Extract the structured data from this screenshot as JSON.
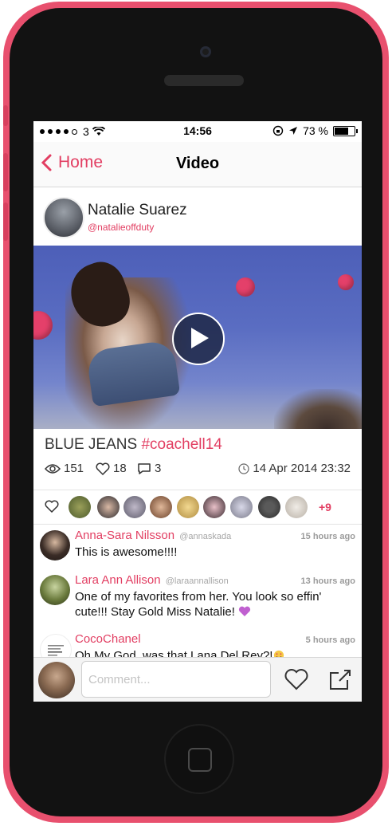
{
  "status_bar": {
    "carrier": "3",
    "time": "14:56",
    "battery": "73 %"
  },
  "nav": {
    "back_label": "Home",
    "title": "Video"
  },
  "author": {
    "name": "Natalie Suarez",
    "handle": "@natalieoffduty"
  },
  "post": {
    "caption_text": "BLUE JEANS ",
    "caption_tag": "#coachell14",
    "views": "151",
    "likes": "18",
    "comments": "3",
    "date": "14 Apr 2014 23:32"
  },
  "likers": {
    "more": "+9"
  },
  "comments": [
    {
      "name": "Anna-Sara Nilsson",
      "handle": "@annaskada",
      "time": "15 hours ago",
      "text": "This is awesome!!!!"
    },
    {
      "name": "Lara Ann Allison",
      "handle": "@laraannallison",
      "time": "13 hours ago",
      "text": "One of my favorites from her. You look so effin' cute!!! Stay Gold Miss Natalie!"
    },
    {
      "name": "CocoChanel",
      "handle": "",
      "time": "5 hours ago",
      "text": "Oh My God, was that Lana Del Rey?!"
    }
  ],
  "composer": {
    "placeholder": "Comment..."
  },
  "colors": {
    "accent": "#e23e62",
    "phone": "#e8506e"
  }
}
